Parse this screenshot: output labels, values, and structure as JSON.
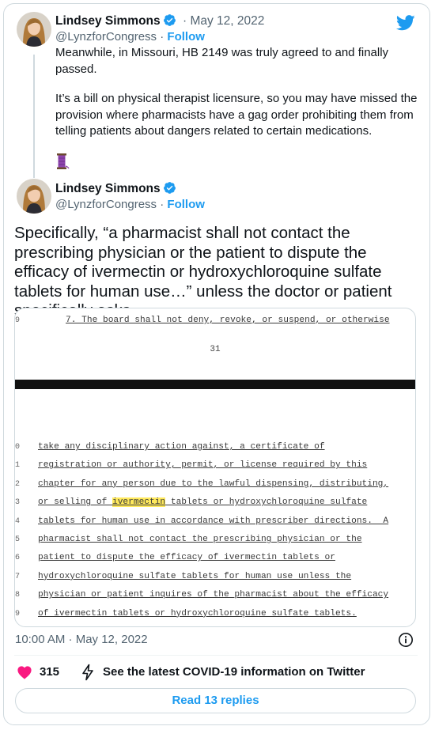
{
  "first_tweet": {
    "author_name": "Lindsey Simmons",
    "date_separator": "·",
    "date": "May 12, 2022",
    "handle": "@LynzforCongress",
    "handle_separator": "·",
    "follow_label": "Follow",
    "text_p1": "Meanwhile, in Missouri, HB 2149 was truly agreed to and finally passed.",
    "text_p2": "It’s a bill on physical therapist licensure, so you may have missed the provision where pharmacists have a gag order prohibiting them from telling patients about dangers related to certain medications.",
    "emoji": "thread-emoji"
  },
  "second_tweet": {
    "author_name": "Lindsey Simmons",
    "handle": "@LynzforCongress",
    "handle_separator": "·",
    "follow_label": "Follow",
    "text": "Specifically, “a pharmacist shall not contact the prescribing physician or the patient to dispute the efficacy of ivermectin or hydroxychloroquine sulfate tablets for human use…” unless the doctor or patient specifically asks."
  },
  "document": {
    "top_line_number": "9",
    "top_line": "7.  The board shall not deny, revoke, or suspend, or otherwise",
    "page_number": "31",
    "lines": [
      {
        "num": "0",
        "text": "take any disciplinary action against, a certificate of"
      },
      {
        "num": "1",
        "text": "registration or authority, permit, or license required by this"
      },
      {
        "num": "2",
        "text": "chapter for any person due to the lawful dispensing, distributing,"
      },
      {
        "num": "3",
        "before": "or selling of ",
        "highlight": "ivermectin",
        "after": " tablets or hydroxychloroquine sulfate"
      },
      {
        "num": "4",
        "text": "tablets for human use in accordance with prescriber directions.  A"
      },
      {
        "num": "5",
        "text": "pharmacist shall not contact the prescribing physician or the"
      },
      {
        "num": "6",
        "text": "patient to dispute the efficacy of ivermectin tablets or"
      },
      {
        "num": "7",
        "text": "hydroxychloroquine sulfate tablets for human use unless the"
      },
      {
        "num": "8",
        "text": "physician or patient inquires of the pharmacist about the efficacy"
      },
      {
        "num": "9",
        "text": "of ivermectin tablets or hydroxychloroquine sulfate tablets."
      }
    ]
  },
  "footer": {
    "timestamp": "10:00 AM · May 12, 2022",
    "like_count": "315",
    "covid_link": "See the latest COVID-19 information on Twitter",
    "replies_button": "Read 13 replies"
  },
  "colors": {
    "accent": "#1d9bf0",
    "muted": "#536471",
    "heart": "#f91880",
    "highlight": "#ffe95c"
  }
}
